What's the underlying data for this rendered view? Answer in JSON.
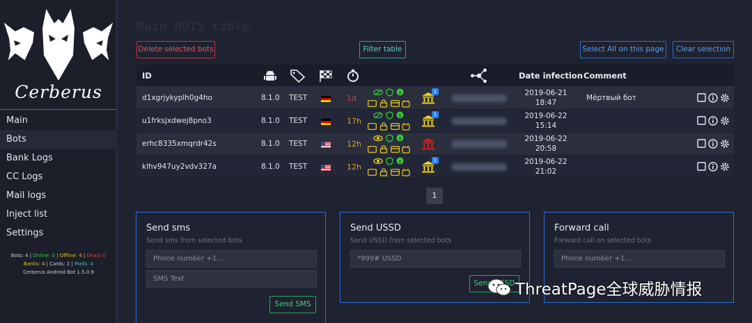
{
  "sidebar": {
    "brand": "Cerberus",
    "menu": [
      "Main",
      "Bots",
      "Bank Logs",
      "CC Logs",
      "Mail logs",
      "Inject list",
      "Settings"
    ],
    "active_index": 1,
    "stats": {
      "bots_label": "Bots:",
      "bots": "4",
      "online_label": "Online:",
      "online": "0",
      "offline_label": "Offline:",
      "offline": "4",
      "dead_label": "Dead:",
      "dead": "0",
      "banks_label": "Banks:",
      "banks": "4",
      "cards_label": "Cards:",
      "cards": "2",
      "mails_label": "Mails:",
      "mails": "4",
      "version": "Cerberus Android Bot 1.5.0.9"
    }
  },
  "main": {
    "title": "Main BOTS table",
    "buttons": {
      "delete": "Delete selected bots",
      "filter": "Filter table",
      "select_all": "Select All on this page",
      "clear": "Clear selection"
    },
    "headers": {
      "id": "ID",
      "date": "Date infection",
      "comment": "Comment"
    },
    "rows": [
      {
        "id": "d1xgrjykyplh0g4ho",
        "version": "8.1.0",
        "tag": "TEST",
        "country": "de",
        "time": "1d",
        "time_color": "#e04040",
        "eye_icon": "eye-slash-icon",
        "bank_color": "#f0d020",
        "bank_badge": "1",
        "date": "2019-06-21",
        "clock": "18:47",
        "comment": "Мёртвый бот"
      },
      {
        "id": "u1frksjxdwej8pno3",
        "version": "8.1.0",
        "tag": "TEST",
        "country": "de",
        "time": "17h",
        "time_color": "#e8a020",
        "eye_icon": "eye-slash-icon",
        "bank_color": "#f0d020",
        "bank_badge": "1",
        "date": "2019-06-22",
        "clock": "15:14",
        "comment": ""
      },
      {
        "id": "erhc8335xmqrdr42s",
        "version": "8.1.0",
        "tag": "TEST",
        "country": "us",
        "time": "12h",
        "time_color": "#e8a020",
        "eye_icon": "eye-icon",
        "bank_color": "#d02020",
        "bank_badge": "",
        "date": "2019-06-22",
        "clock": "20:58",
        "comment": ""
      },
      {
        "id": "klhv947uy2vdv327a",
        "version": "8.1.0",
        "tag": "TEST",
        "country": "us",
        "time": "12h",
        "time_color": "#e8a020",
        "eye_icon": "eye-icon",
        "bank_color": "#f0d020",
        "bank_badge": "1",
        "date": "2019-06-22",
        "clock": "21:02",
        "comment": ""
      }
    ],
    "pagination": {
      "current": "1"
    }
  },
  "panels": {
    "sms": {
      "title": "Send sms",
      "subtitle": "Send sms from selected bots",
      "phone_placeholder": "Phone number +1...",
      "text_placeholder": "SMS Text",
      "button": "Send SMS"
    },
    "ussd": {
      "title": "Send USSD",
      "subtitle": "Send USSD from selected bots",
      "code_placeholder": "*999# USSD",
      "button": "Send USSD"
    },
    "forward": {
      "title": "Forward call",
      "subtitle": "Forward call on selected bots",
      "phone_placeholder": "Phone number +1..."
    }
  },
  "watermark": {
    "text": "ThreatPage全球威胁情报"
  },
  "colors": {
    "accent_blue": "#2b6fd6",
    "green_status": "#37c837",
    "yellow_status": "#f0d020",
    "red": "#c8333f"
  }
}
